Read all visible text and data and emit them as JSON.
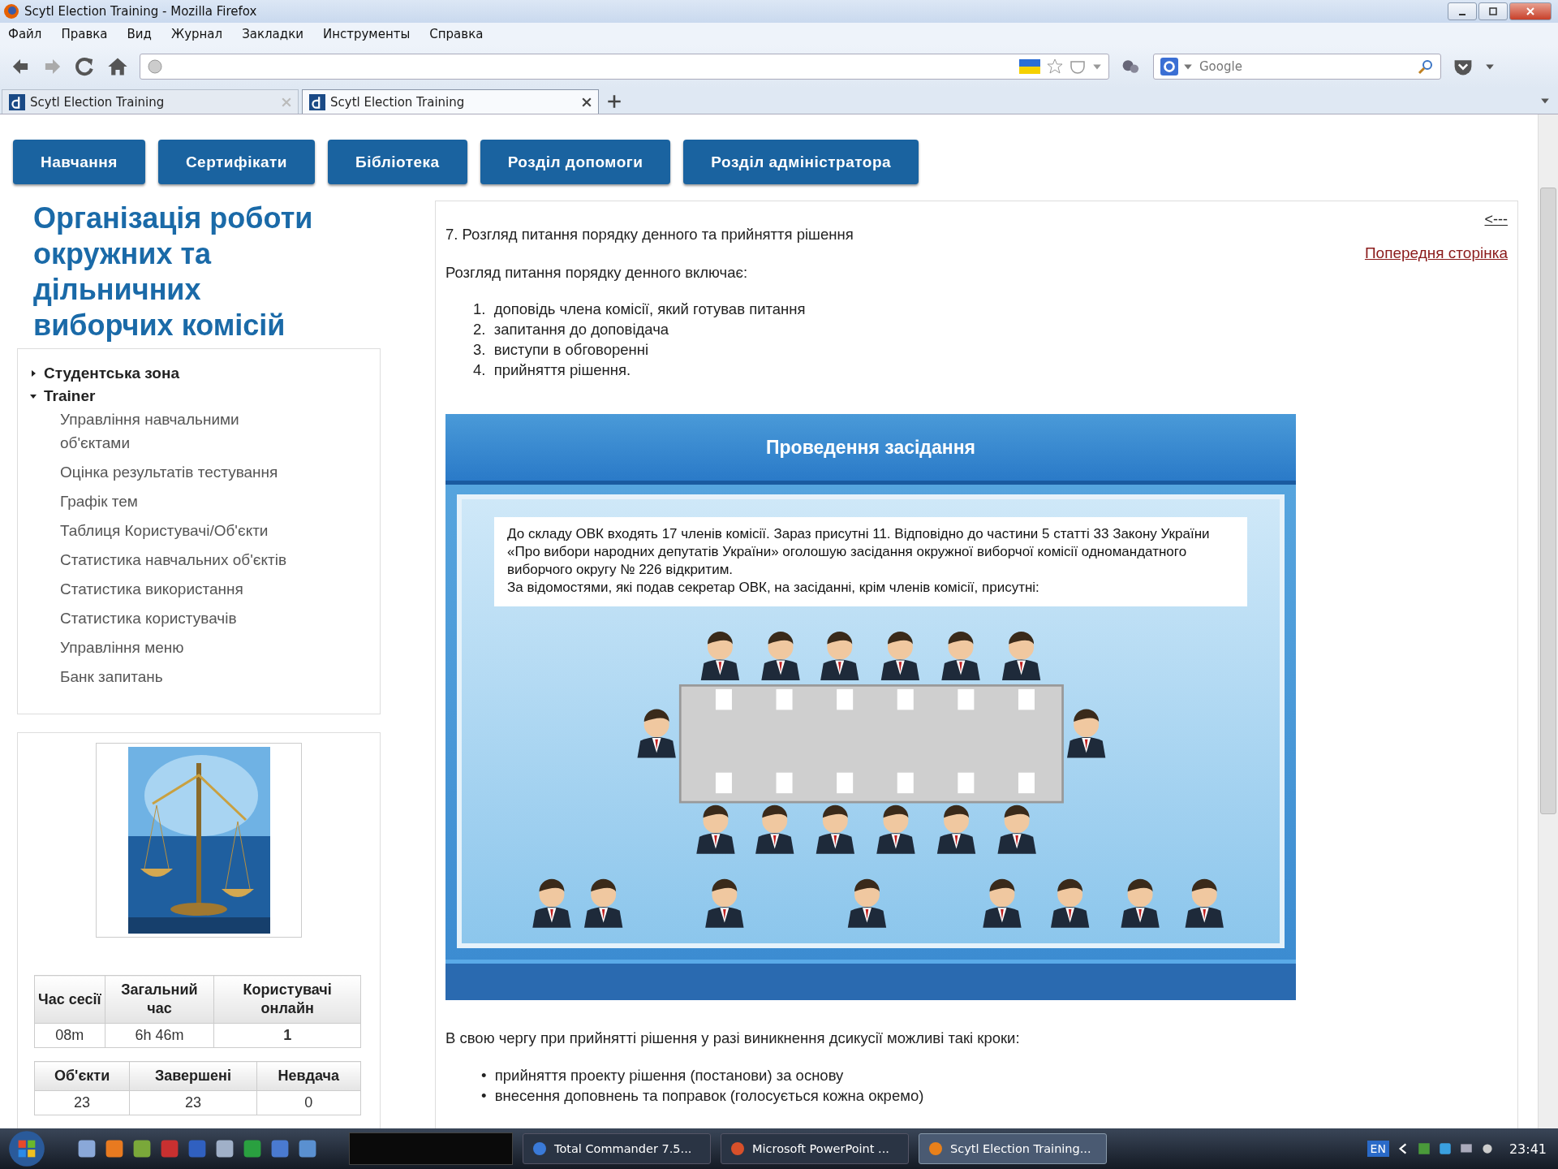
{
  "window": {
    "title": "Scytl Election Training - Mozilla Firefox"
  },
  "menu": [
    "Файл",
    "Правка",
    "Вид",
    "Журнал",
    "Закладки",
    "Инструменты",
    "Справка"
  ],
  "search": {
    "placeholder": "Google"
  },
  "tabs": [
    {
      "label": "Scytl Election Training",
      "selected": false
    },
    {
      "label": "Scytl Election Training",
      "selected": true
    }
  ],
  "nav": [
    "Навчання",
    "Сертифікати",
    "Бібліотека",
    "Розділ допомоги",
    "Розділ адміністратора"
  ],
  "sidebar": {
    "title": "Організація роботи окружних та дільничних виборчих комісій",
    "tree": [
      {
        "label": "Студентська зона",
        "expanded": false
      },
      {
        "label": "Trainer",
        "expanded": true,
        "children": [
          "Управління навчальними об'єктами",
          "Оцінка результатів тестування",
          "Графік тем",
          "Таблиця Користувачі/Об'єкти",
          "Статистика навчальних об'єктів",
          "Статистика використання",
          "Статистика користувачів",
          "Управління меню",
          "Банк запитань"
        ]
      }
    ]
  },
  "stats": [
    {
      "columns": [
        "Час сесії",
        "Загальний час",
        "Користувачі онлайн"
      ],
      "rows": [
        [
          "08m",
          "6h 46m",
          "**1**"
        ]
      ]
    },
    {
      "columns": [
        "Об'єкти",
        "Завершені",
        "Невдача"
      ],
      "rows": [
        [
          "23",
          "23",
          "0"
        ]
      ]
    }
  ],
  "content": {
    "back_link": "<---",
    "prev_link": "Попередня сторінка",
    "heading": "7. Розгляд питання порядку денного та прийняття рішення",
    "intro": "Розгляд питання порядку денного включає:",
    "steps": [
      "1.  доповідь члена комісії, який готував питання",
      "2.  запитання до доповідача",
      "3.  виступи в обговоренні",
      "4.  прийняття рішення."
    ],
    "slide": {
      "title": "Проведення засідання",
      "bubble": [
        "До складу ОВК входять 17 членів  комісії. Зараз присутні 11. Відповідно до частини 5  статті 33  Закону України «Про вибори народних депутатів України» оголошую засідання окружної виборчої комісії одномандатного виборчого округу № 226 відкритим.",
        "За відомостями, які подав секретар ОВК, на засіданні, крім членів комісії, присутні:"
      ]
    },
    "outro": "В свою чергу при прийнятті рішення у разі виникнення дсикусії можливі такі кроки:",
    "options": [
      "•  прийняття проекту рішення (постанови) за основу",
      "•  внесення доповнень та поправок (голосується кожна окремо)"
    ]
  },
  "taskbar": {
    "tasks": [
      {
        "label": "Total Commander 7.5...",
        "selected": false
      },
      {
        "label": "Microsoft PowerPoint ...",
        "selected": false
      },
      {
        "label": "Scytl Election Training...",
        "selected": true
      }
    ],
    "lang": "EN",
    "clock": "23:41"
  }
}
